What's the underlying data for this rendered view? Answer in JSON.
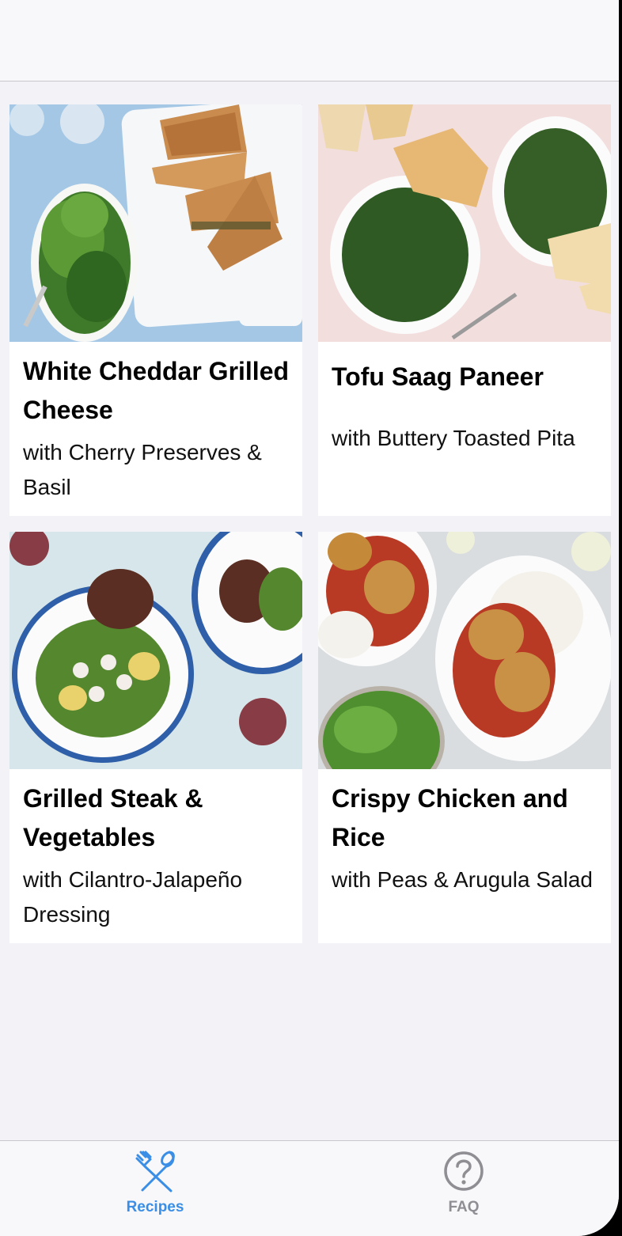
{
  "recipes": [
    {
      "title": "White Cheddar Grilled Cheese",
      "subtitle": "with Cherry Preserves & Basil"
    },
    {
      "title": "Tofu Saag Paneer",
      "subtitle": "with Buttery Toasted Pita"
    },
    {
      "title": "Grilled Steak & Vegetables",
      "subtitle": "with Cilantro-Jalapeño Dressing"
    },
    {
      "title": "Crispy Chicken and Rice",
      "subtitle": "with Peas & Arugula Salad"
    }
  ],
  "tabbar": {
    "recipes_label": "Recipes",
    "faq_label": "FAQ",
    "recipes_icon": "fork-spoon-icon",
    "faq_icon": "question-circle-icon",
    "active_color": "#3a8ee6",
    "inactive_color": "#8e8e93"
  }
}
